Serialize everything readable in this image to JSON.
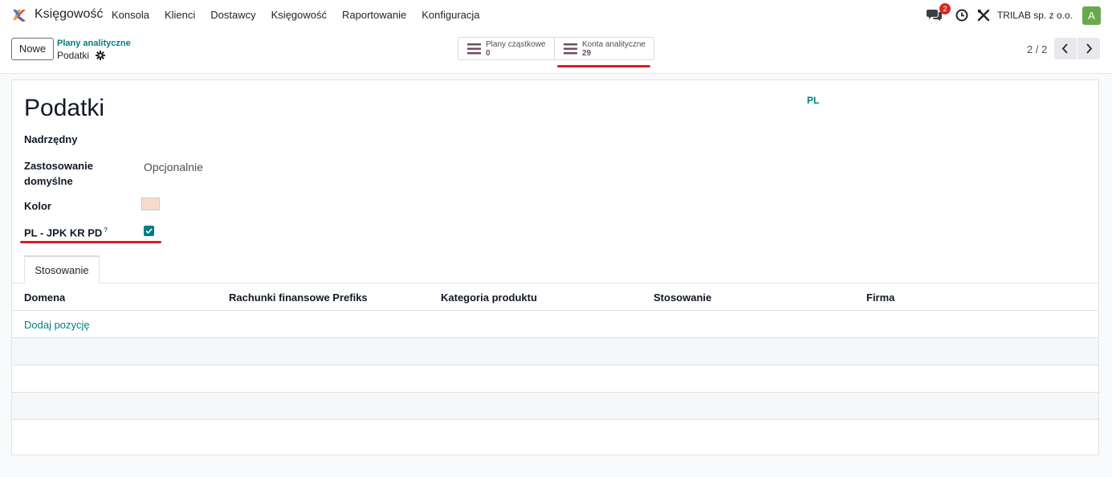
{
  "navbar": {
    "app_name": "Księgowość",
    "menu": [
      "Konsola",
      "Klienci",
      "Dostawcy",
      "Księgowość",
      "Raportowanie",
      "Konfiguracja"
    ],
    "chat_badge": "2",
    "company": "TRILAB sp. z o.o.",
    "avatar_letter": "A"
  },
  "control": {
    "new_label": "Nowe",
    "breadcrumb_parent": "Plany analityczne",
    "breadcrumb_current": "Podatki",
    "smart_buttons": [
      {
        "label": "Plany cząstkowe",
        "value": "0"
      },
      {
        "label": "Konta analityczne",
        "value": "29"
      }
    ],
    "pager": "2 / 2"
  },
  "form": {
    "title": "Podatki",
    "code": "PL",
    "parent_label": "Nadrzędny",
    "default_applicability_label_1": "Zastosowanie",
    "default_applicability_label_2": "domyślne",
    "default_applicability_value": "Opcjonalnie",
    "color_label": "Kolor",
    "color_value": "#f9dbcd",
    "jpk_label": "PL - JPK KR PD",
    "jpk_help": "?",
    "jpk_checked": true
  },
  "tabs": {
    "applicability": "Stosowanie"
  },
  "table": {
    "columns": [
      "Domena",
      "Rachunki finansowe Prefiks",
      "Kategoria produktu",
      "Stosowanie",
      "Firma"
    ],
    "add_line": "Dodaj pozycję"
  },
  "colors": {
    "accent": "#017e84",
    "brand": "#714b67",
    "highlight": "#d91e2b"
  }
}
